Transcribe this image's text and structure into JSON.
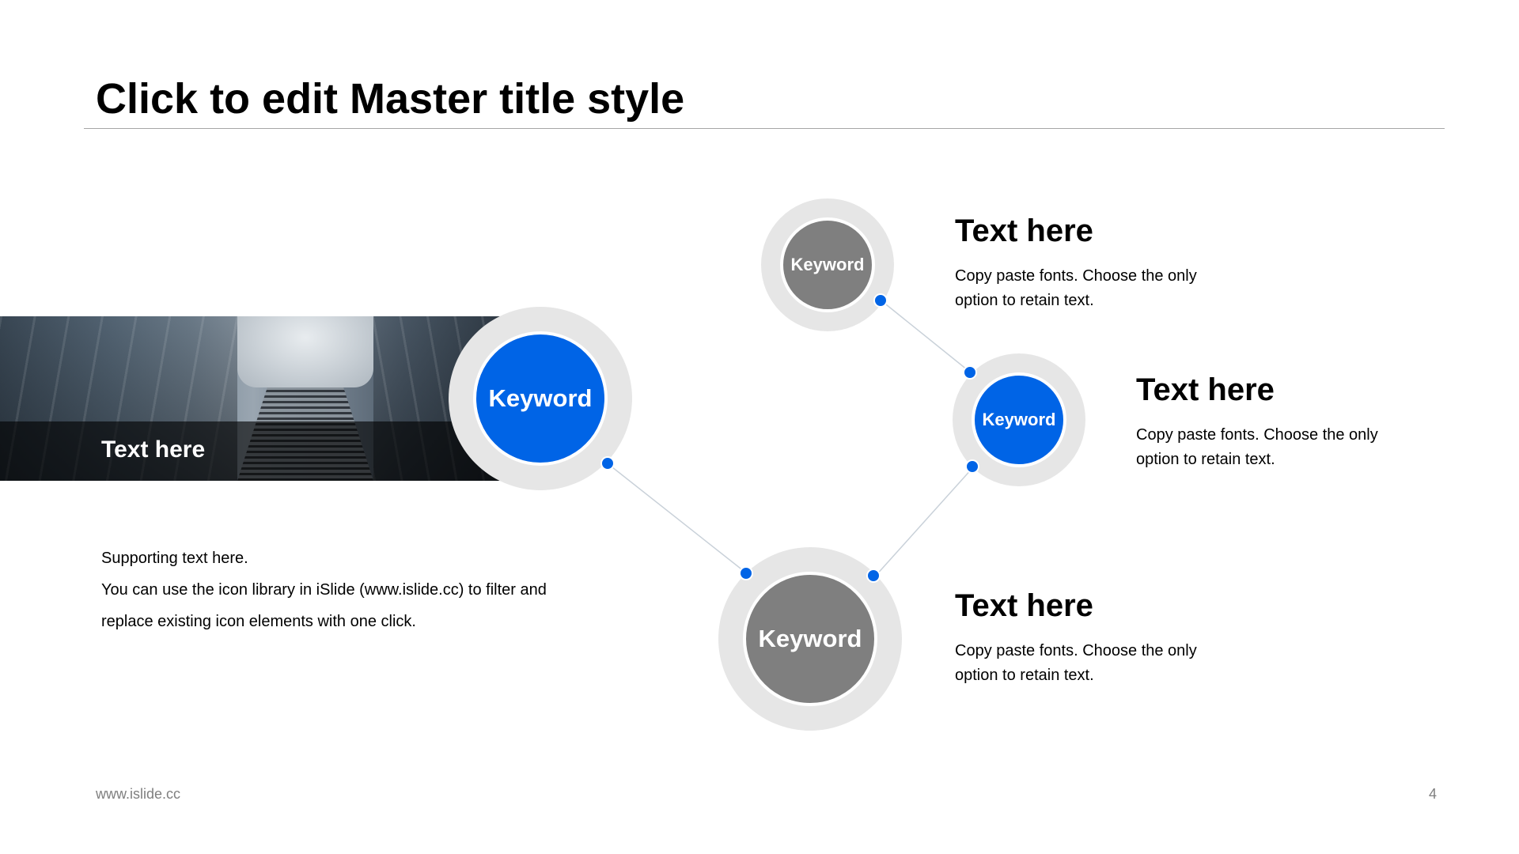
{
  "slide": {
    "title": "Click to edit Master title style",
    "footer_url": "www.islide.cc",
    "page_number": "4"
  },
  "banner": {
    "label": "Text here"
  },
  "supporting_text": {
    "line1": "Supporting text here.",
    "line2": "You can use the icon library in iSlide  (www.islide.cc)  to filter and",
    "line3": "replace existing icon elements with one click."
  },
  "nodes": {
    "main": {
      "label": "Keyword",
      "color": "#0064e6"
    },
    "top": {
      "label": "Keyword",
      "color": "#7f7f7f"
    },
    "middle": {
      "label": "Keyword",
      "color": "#0064e6"
    },
    "bottom": {
      "label": "Keyword",
      "color": "#7f7f7f"
    }
  },
  "items": [
    {
      "heading": "Text here",
      "line1": "Copy paste fonts. Choose the only",
      "line2": "option to retain text."
    },
    {
      "heading": "Text here",
      "line1": "Copy paste fonts. Choose the only",
      "line2": "option to retain text."
    },
    {
      "heading": "Text here",
      "line1": "Copy paste fonts. Choose the only",
      "line2": "option to retain text."
    }
  ],
  "colors": {
    "accent": "#0064e6",
    "neutral": "#7f7f7f",
    "ring": "#e6e6e6",
    "connector": "#c9d1d9"
  }
}
